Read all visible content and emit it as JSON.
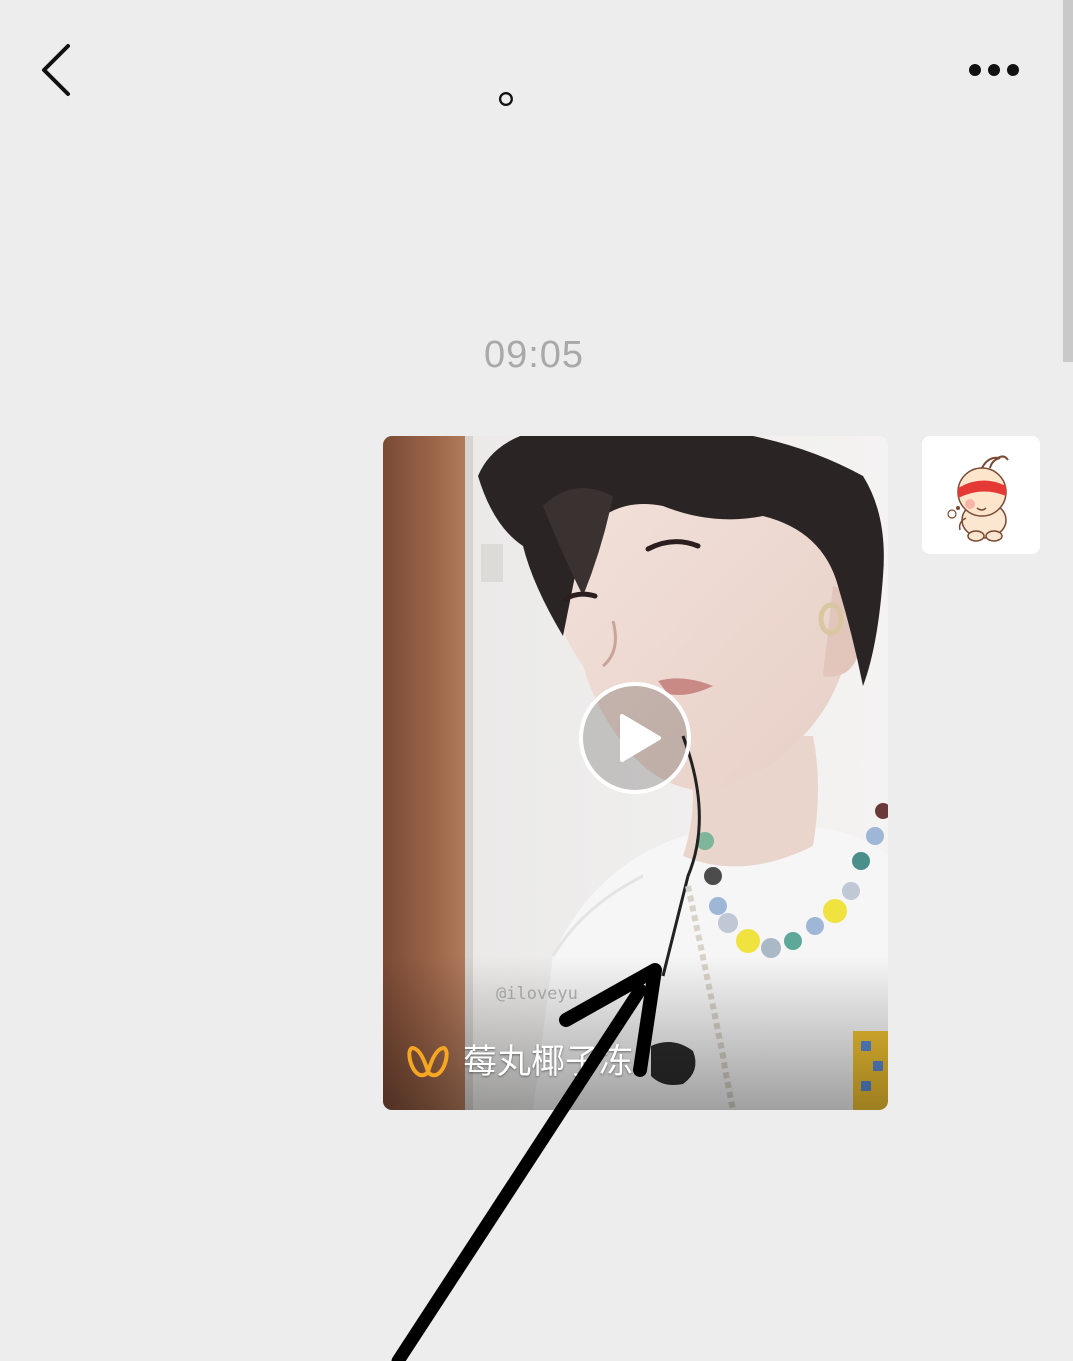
{
  "header": {
    "title": "。",
    "back_icon": "chevron-left-icon",
    "more_icon": "more-dots-icon"
  },
  "chat": {
    "timestamp": "09:05",
    "video_message": {
      "source_label": "莓丸椰子冻",
      "watermark": "@iloveyu",
      "play_icon": "play-icon",
      "source_logo_icon": "butterfly-logo-icon"
    },
    "avatar_icon": "cartoon-baby-avatar"
  },
  "colors": {
    "background": "#ededed",
    "timestamp": "#a9a9a9",
    "logo_accent": "#f5a623",
    "avatar_band": "#e53935"
  }
}
